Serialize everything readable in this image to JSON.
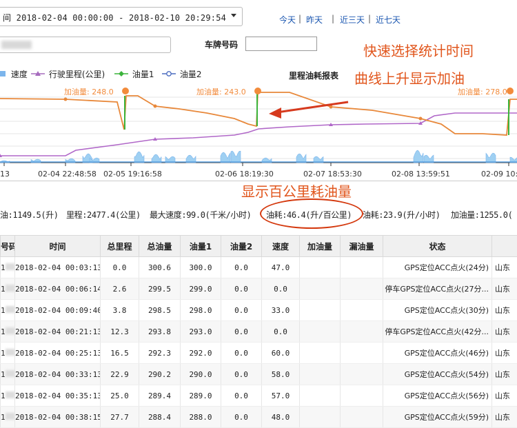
{
  "filters": {
    "date_prefix": "间",
    "date_range": "2018-02-04 00:00:00 - 2018-02-10 20:29:54",
    "plate_label": "车牌号码",
    "plate_value": ""
  },
  "quick_links": [
    "今天",
    "昨天",
    "近三天",
    "近七天"
  ],
  "separator": "|",
  "annotations": {
    "quick_select": "快速选择统计时间",
    "curve_rise": "曲线上升显示加油",
    "consumption": "显示百公里耗油量"
  },
  "legend": [
    {
      "label": "速度",
      "color": "#7cb5ec",
      "marker": "square"
    },
    {
      "label": "行驶里程(公里)",
      "color": "#a66bbe",
      "marker": "triangle"
    },
    {
      "label": "油量1",
      "color": "#3cb43c",
      "marker": "diamond"
    },
    {
      "label": "油量2",
      "color": "#4a6bbf",
      "marker": "circle"
    }
  ],
  "colors": {
    "fuel": "#e8883a",
    "mileage": "#b067c8",
    "speed": "#9fd0f2",
    "refuel_marker": "#f28b3c",
    "annotation": "#e1561d",
    "link": "#1a56b0"
  },
  "chart_data": {
    "type": "line",
    "title": "里程油耗报表",
    "x_ticks": [
      "13",
      "02-04 22:48:58",
      "02-05 19:16:58",
      "02-06 18:19:30",
      "02-07 18:53:30",
      "02-08 13:59:51",
      "02-09 10:"
    ],
    "refuel_labels": [
      "加油量: 248.0",
      "加油量: 243.0",
      "加油量: 278.0"
    ],
    "series": [
      {
        "name": "油量1",
        "type": "line",
        "points": [
          [
            0,
            143
          ],
          [
            95,
            144
          ],
          [
            170,
            148
          ],
          [
            180,
            188
          ],
          [
            183,
            139
          ],
          [
            200,
            139
          ],
          [
            225,
            154
          ],
          [
            260,
            158
          ],
          [
            300,
            164
          ],
          [
            340,
            172
          ],
          [
            360,
            180
          ],
          [
            372,
            183
          ],
          [
            374,
            134
          ],
          [
            420,
            134
          ],
          [
            480,
            155
          ],
          [
            540,
            160
          ],
          [
            610,
            172
          ],
          [
            640,
            180
          ],
          [
            660,
            194
          ],
          [
            700,
            194
          ],
          [
            735,
            196
          ],
          [
            740,
            144
          ],
          [
            750,
            144
          ]
        ]
      },
      {
        "name": "行驶里程(公里)",
        "type": "line",
        "points": [
          [
            0,
            226
          ],
          [
            95,
            226
          ],
          [
            110,
            218
          ],
          [
            170,
            210
          ],
          [
            225,
            202
          ],
          [
            280,
            200
          ],
          [
            310,
            198
          ],
          [
            340,
            196
          ],
          [
            360,
            192
          ],
          [
            375,
            187
          ],
          [
            420,
            184
          ],
          [
            480,
            181
          ],
          [
            530,
            180
          ],
          [
            610,
            179
          ],
          [
            630,
            168
          ],
          [
            660,
            164
          ],
          [
            750,
            164
          ]
        ]
      },
      {
        "name": "速度",
        "type": "area",
        "bursts": [
          [
            0,
            3
          ],
          [
            45,
            5
          ],
          [
            95,
            6
          ],
          [
            120,
            13
          ],
          [
            130,
            7
          ],
          [
            195,
            16
          ],
          [
            220,
            12
          ],
          [
            240,
            9
          ],
          [
            270,
            11
          ],
          [
            320,
            15
          ],
          [
            335,
            17
          ],
          [
            380,
            7
          ],
          [
            430,
            13
          ],
          [
            455,
            9
          ],
          [
            600,
            18
          ],
          [
            615,
            11
          ],
          [
            705,
            14
          ],
          [
            740,
            8
          ]
        ]
      }
    ]
  },
  "summary": [
    {
      "key": "oil_total",
      "text": "油:1149.5(升)"
    },
    {
      "key": "mileage",
      "text": "里程:2477.4(公里)"
    },
    {
      "key": "max_speed",
      "text": "最大速度:99.0(千米/小时)"
    },
    {
      "key": "consumption",
      "text": "油耗:46.4(升/百公里)"
    },
    {
      "key": "hourly",
      "text": "油耗:23.9(升/小时)"
    },
    {
      "key": "refuel",
      "text": "加油量:1255.0("
    }
  ],
  "table": {
    "headers": [
      "号码",
      "时间",
      "总里程",
      "总油量",
      "油量1",
      "油量2",
      "速度",
      "加油量",
      "漏油量",
      "状态",
      ""
    ],
    "rows": [
      [
        "1",
        "2018-02-04 00:03:13",
        "0.0",
        "300.6",
        "300.0",
        "0.0",
        "47.0",
        "",
        "",
        "GPS定位ACC点火(24分)",
        "山东"
      ],
      [
        "1",
        "2018-02-04 00:06:14",
        "2.6",
        "299.5",
        "299.0",
        "0.0",
        "0.0",
        "",
        "",
        "停车GPS定位ACC点火(27分...",
        "山东"
      ],
      [
        "1",
        "2018-02-04 00:09:40",
        "3.8",
        "298.5",
        "298.0",
        "0.0",
        "33.0",
        "",
        "",
        "GPS定位ACC点火(30分)",
        "山东"
      ],
      [
        "1",
        "2018-02-04 00:21:13",
        "12.3",
        "293.8",
        "293.0",
        "0.0",
        "0.0",
        "",
        "",
        "停车GPS定位ACC点火(42分...",
        "山东"
      ],
      [
        "1",
        "2018-02-04 00:25:13",
        "16.5",
        "292.3",
        "292.0",
        "0.0",
        "60.0",
        "",
        "",
        "GPS定位ACC点火(46分)",
        "山东"
      ],
      [
        "1",
        "2018-02-04 00:33:13",
        "22.9",
        "290.2",
        "290.0",
        "0.0",
        "58.0",
        "",
        "",
        "GPS定位ACC点火(54分)",
        "山东"
      ],
      [
        "1",
        "2018-02-04 00:35:13",
        "25.0",
        "289.4",
        "289.0",
        "0.0",
        "57.0",
        "",
        "",
        "GPS定位ACC点火(56分)",
        "山东"
      ],
      [
        "1",
        "2018-02-04 00:38:15",
        "27.7",
        "288.4",
        "288.0",
        "0.0",
        "48.0",
        "",
        "",
        "GPS定位ACC点火(59分)",
        "山东"
      ]
    ]
  }
}
